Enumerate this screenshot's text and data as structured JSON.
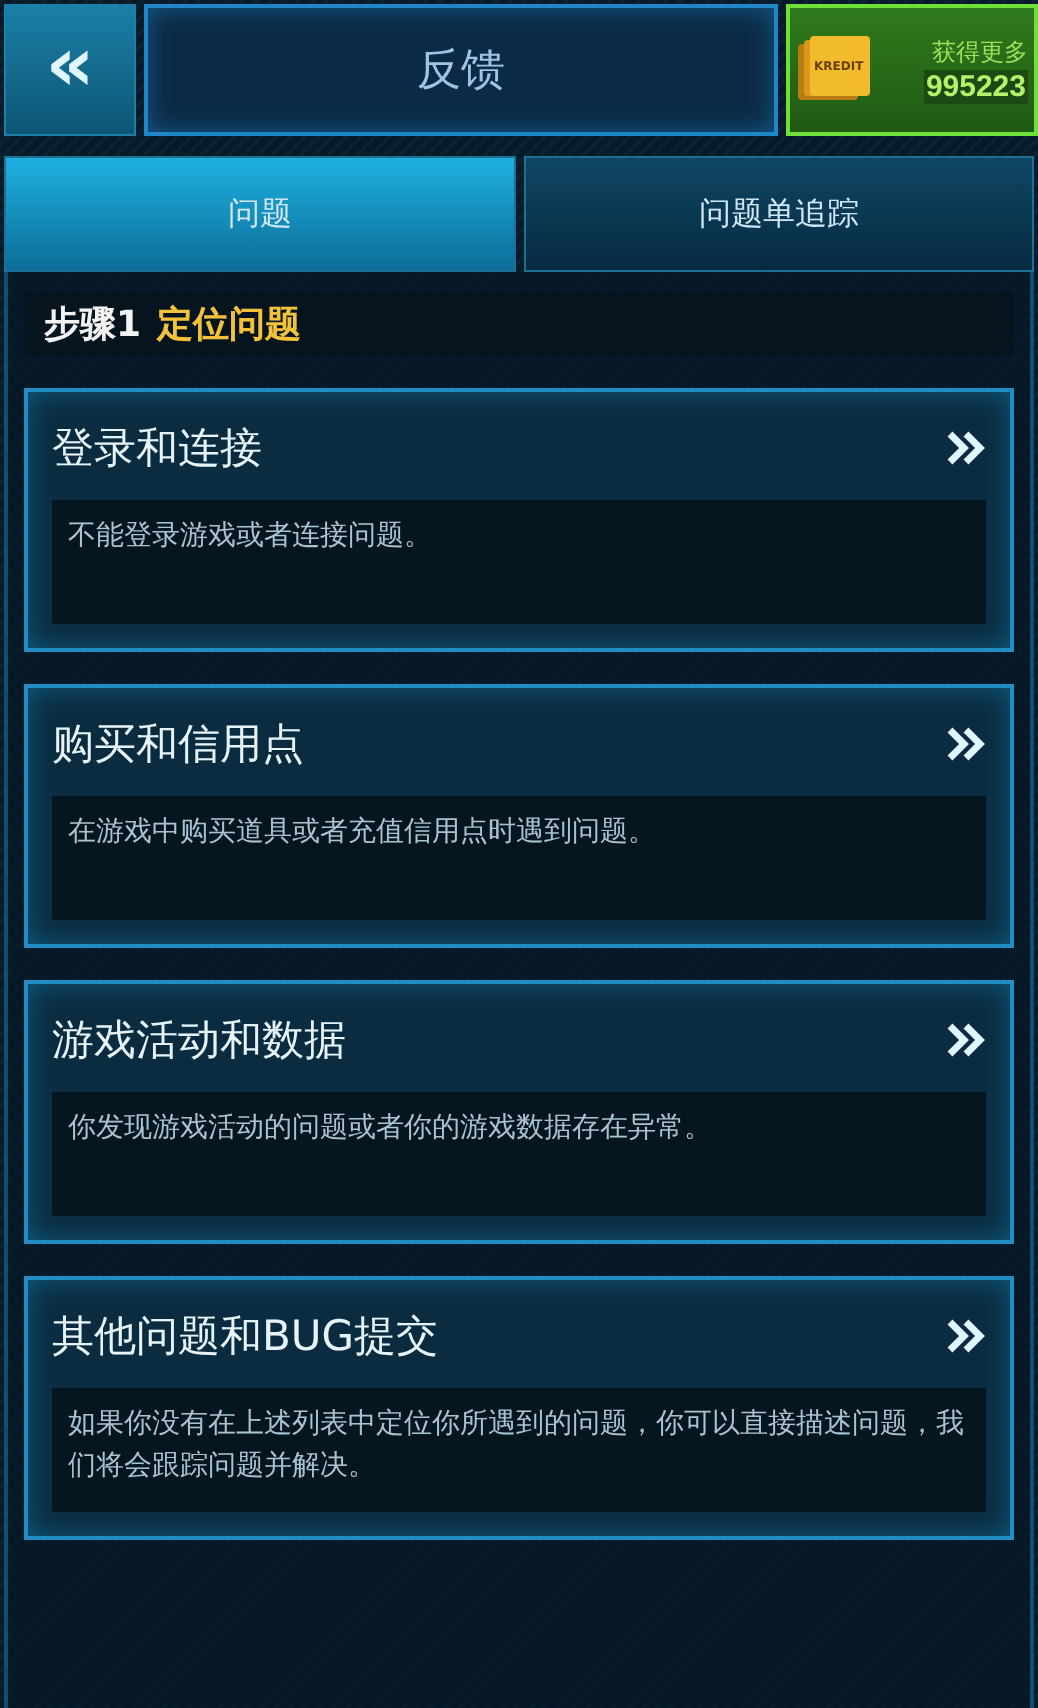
{
  "header": {
    "back_icon": "«",
    "title": "反馈",
    "credits": {
      "card_label": "KREDIT",
      "label": "获得更多",
      "amount": "995223"
    }
  },
  "tabs": [
    {
      "label": "问题",
      "selected": true
    },
    {
      "label": "问题单追踪",
      "selected": false
    }
  ],
  "step": {
    "number": "步骤1",
    "title": "定位问题"
  },
  "categories": [
    {
      "title": "登录和连接",
      "description": "不能登录游戏或者连接问题。"
    },
    {
      "title": "购买和信用点",
      "description": "在游戏中购买道具或者充值信用点时遇到问题。"
    },
    {
      "title": "游戏活动和数据",
      "description": "你发现游戏活动的问题或者你的游戏数据存在异常。"
    },
    {
      "title": "其他问题和BUG提交",
      "description": "如果你没有在上述列表中定位你所遇到的问题，你可以直接描述问题，我们将会跟踪问题并解决。"
    }
  ]
}
